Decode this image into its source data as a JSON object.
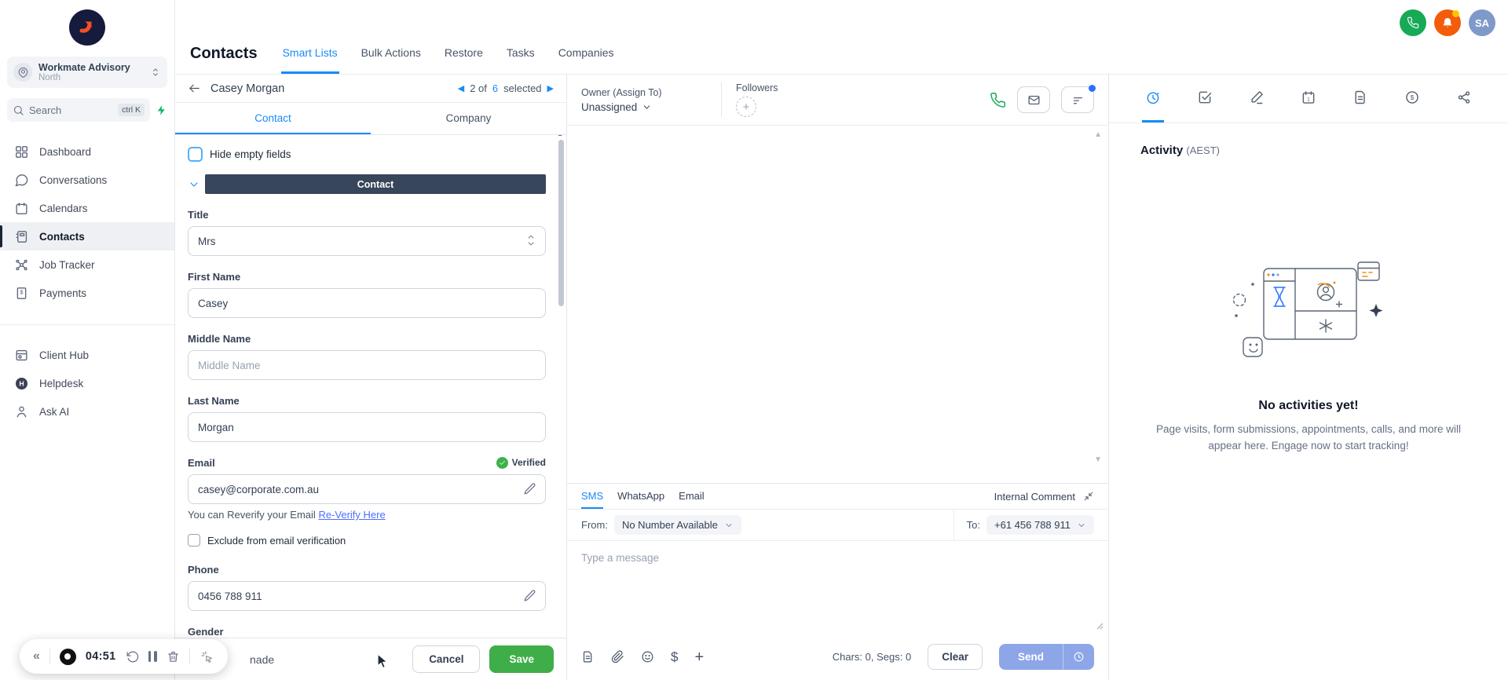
{
  "topbar": {
    "avatar_initials": "SA"
  },
  "sidebar": {
    "agency": {
      "name": "Workmate Advisory",
      "location": "North"
    },
    "search": {
      "placeholder": "Search",
      "shortcut": "ctrl K"
    },
    "nav": [
      {
        "label": "Dashboard"
      },
      {
        "label": "Conversations"
      },
      {
        "label": "Calendars"
      },
      {
        "label": "Contacts"
      },
      {
        "label": "Job Tracker"
      },
      {
        "label": "Payments"
      }
    ],
    "nav_secondary": [
      {
        "label": "Client Hub"
      },
      {
        "label": "Helpdesk"
      },
      {
        "label": "Ask AI"
      }
    ]
  },
  "header": {
    "title": "Contacts",
    "tabs": [
      {
        "label": "Smart Lists"
      },
      {
        "label": "Bulk Actions"
      },
      {
        "label": "Restore"
      },
      {
        "label": "Tasks"
      },
      {
        "label": "Companies"
      }
    ]
  },
  "contact_panel": {
    "name": "Casey Morgan",
    "pager": {
      "current": "2 of",
      "count": "6",
      "suffix": "selected"
    },
    "tabs": [
      {
        "label": "Contact"
      },
      {
        "label": "Company"
      }
    ],
    "hide_empty_label": "Hide empty fields",
    "section_title": "Contact",
    "fields": {
      "title": {
        "label": "Title",
        "value": "Mrs"
      },
      "first_name": {
        "label": "First Name",
        "value": "Casey"
      },
      "middle_name": {
        "label": "Middle Name",
        "placeholder": "Middle Name"
      },
      "last_name": {
        "label": "Last Name",
        "value": "Morgan"
      },
      "email": {
        "label": "Email",
        "value": "casey@corporate.com.au",
        "badge": "Verified",
        "reverify_text": "You can Reverify your Email ",
        "reverify_link": "Re-Verify Here",
        "exclude_label": "Exclude from email verification"
      },
      "phone": {
        "label": "Phone",
        "value": "0456 788 911"
      },
      "gender": {
        "label": "Gender"
      }
    },
    "footer": {
      "hidden_fragment": "nade",
      "cancel": "Cancel",
      "save": "Save"
    }
  },
  "conversation": {
    "owner": {
      "label": "Owner (Assign To)",
      "value": "Unassigned"
    },
    "followers": {
      "label": "Followers"
    },
    "composer": {
      "tabs": [
        {
          "label": "SMS"
        },
        {
          "label": "WhatsApp"
        },
        {
          "label": "Email"
        }
      ],
      "internal_comment": "Internal Comment",
      "from": {
        "label": "From:",
        "value": "No Number Available"
      },
      "to": {
        "label": "To:",
        "value": "+61 456 788 911"
      },
      "placeholder": "Type a message",
      "counter": "Chars: 0, Segs: 0",
      "clear": "Clear",
      "send": "Send"
    }
  },
  "activity_panel": {
    "title": "Activity",
    "timezone": "(AEST)",
    "empty_title": "No activities yet!",
    "empty_description": "Page visits, form submissions, appointments, calls, and more will appear here. Engage now to start tracking!"
  },
  "recorder": {
    "time": "04:51"
  },
  "colors": {
    "accent": "#188bf6",
    "save_green": "#3fae49",
    "send_disabled": "#8da6e8",
    "verified_green": "#3db24b",
    "phone_green": "#18a957",
    "bell_orange": "#f25c0a",
    "avatar_blue": "#7f9ac8",
    "section_dark": "#37465a"
  }
}
